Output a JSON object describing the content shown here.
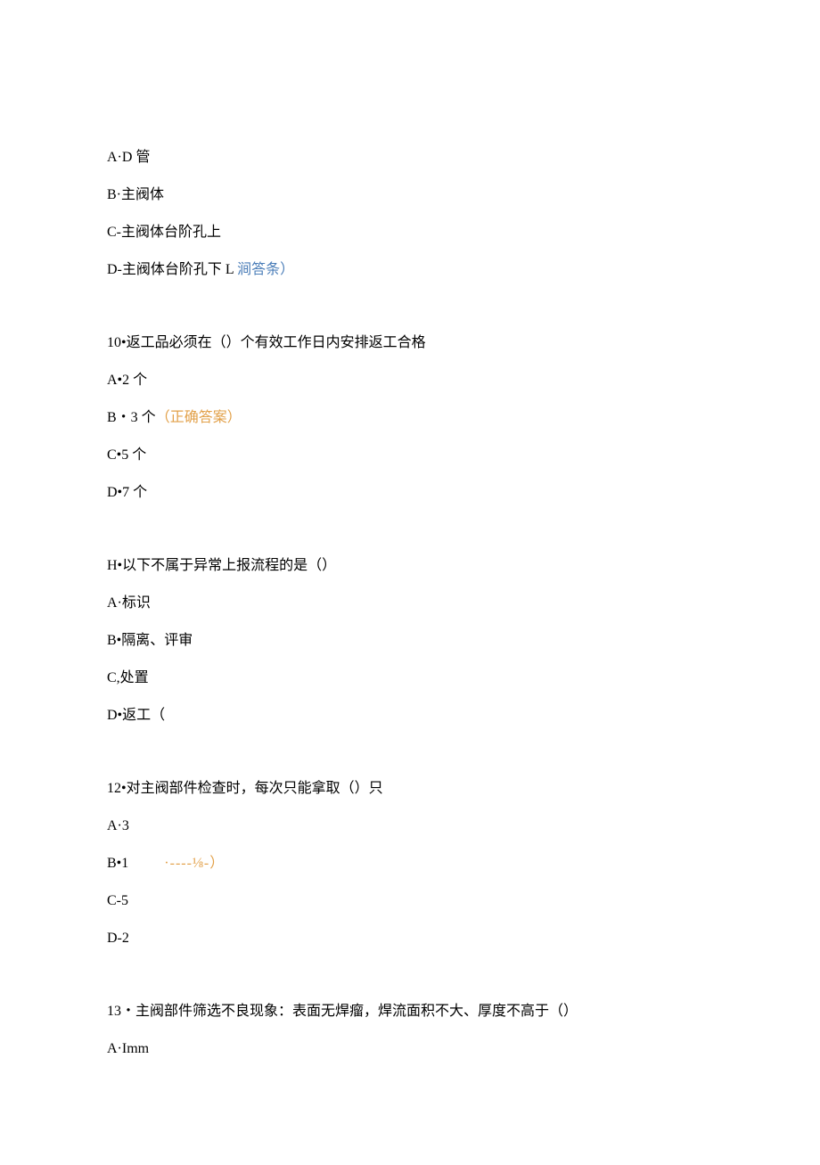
{
  "q9": {
    "a": "A·D 管",
    "b": "B·主阀体",
    "c": "C-主阀体台阶孔上",
    "d_prefix": "D-主阀体台阶孔下 L ",
    "d_answer": "涧答条）"
  },
  "q10": {
    "stem": "10•返工品必须在（）个有效工作日内安排返工合格",
    "a": "A•2 个",
    "b_prefix": "B・3 个",
    "b_answer": "（正确答案）",
    "c": "C•5 个",
    "d": "D•7 个"
  },
  "q11": {
    "stem": "H•以下不属于异常上报流程的是（）",
    "a": "A·标识",
    "b": "B•隔离、评审",
    "c": "C,处置",
    "d": "D•返工（"
  },
  "q12": {
    "stem": "12•对主阀部件检查时，每次只能拿取（）只",
    "a": "A·3",
    "b_prefix": "B•1",
    "b_marker": "·----⅛-）",
    "c": "C-5",
    "d": "D-2"
  },
  "q13": {
    "stem": "13・主阀部件筛选不良现象：表面无焊瘤，焊流面积不大、厚度不高于（）",
    "a": "A·Imm"
  }
}
